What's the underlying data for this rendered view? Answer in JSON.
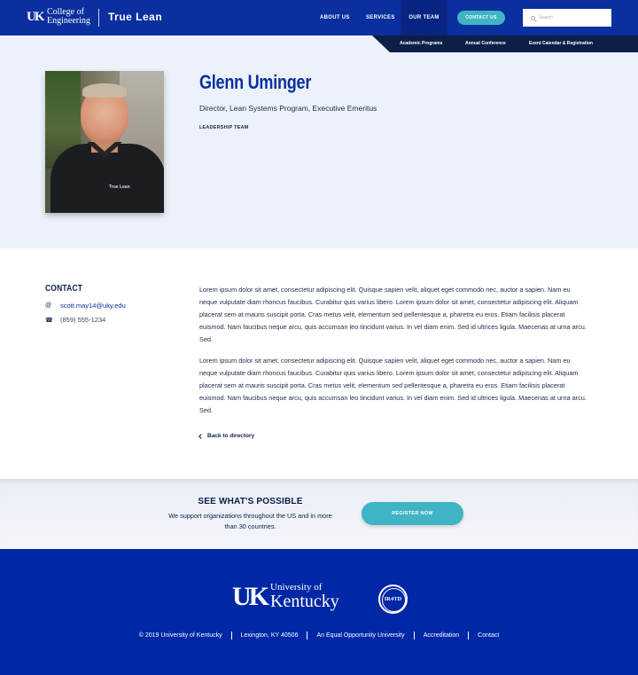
{
  "header": {
    "college_line1": "College of",
    "college_line2": "Engineering",
    "brand": "True Lean",
    "nav": [
      "ABOUT US",
      "SERVICES",
      "OUR TEAM"
    ],
    "contact_button": "CONTACT US",
    "search_placeholder": "Search"
  },
  "subnav": [
    "Academic Programs",
    "Annual Conference",
    "Event Calendar & Registration"
  ],
  "profile": {
    "name": "Glenn Uminger",
    "title": "Director, Lean Systems Program, Executive Emeritus",
    "team": "LEADERSHIP TEAM",
    "photo_shirt_logo": "True Lean"
  },
  "contact": {
    "heading": "CONTACT",
    "email": "scott.may14@uky.edu",
    "phone": "(859) 555-1234"
  },
  "bio": [
    "Lorem ipsum dolor sit amet, consectetur adipiscing elit. Quisque sapien velit, aliquet eget commodo nec, auctor a sapien. Nam eu neque vulputate diam rhoncus faucibus. Curabitur quis varius libero. Lorem ipsum dolor sit amet, consectetur adipiscing elit. Aliquam placerat sem at mauris suscipit porta. Cras metus velit, elementum sed pellentesque a, pharetra eu eros. Etiam facilisis placerat euismod. Nam faucibus neque arcu, quis accumsan leo tincidunt varius. In vel diam enim. Sed id ultrices ligula. Maecenas at urna arcu. Sed.",
    "Lorem ipsum dolor sit amet, consectetur adipiscing elit. Quisque sapien velit, aliquet eget commodo nec, auctor a sapien. Nam eu neque vulputate diam rhoncus faucibus. Curabitur quis varius libero. Lorem ipsum dolor sit amet, consectetur adipiscing elit. Aliquam placerat sem at mauris suscipit porta. Cras metus velit, elementum sed pellentesque a, pharetra eu eros. Etiam facilisis placerat euismod. Nam faucibus neque arcu, quis accumsan leo tincidunt varius. In vel diam enim. Sed id ultrices ligula. Maecenas at urna arcu. Sed."
  ],
  "back_link": "Back to directory",
  "cta": {
    "heading": "SEE WHAT'S POSSIBLE",
    "text": "We support organizations throughout the US and in more than 30 countries.",
    "button": "REGISTER NOW"
  },
  "footer": {
    "uk_line1": "University of",
    "uk_line2": "Kentucky",
    "badge": "IR4TD",
    "links": [
      "© 2019 University of Kentucky",
      "Lexington, KY 40506",
      "An Equal Opportunity University",
      "Accreditation",
      "Contact"
    ]
  },
  "colors": {
    "primary_blue": "#0a2f9e",
    "navy": "#0c1f48",
    "teal": "#3fb4c4",
    "footer_blue": "#0027a6"
  }
}
